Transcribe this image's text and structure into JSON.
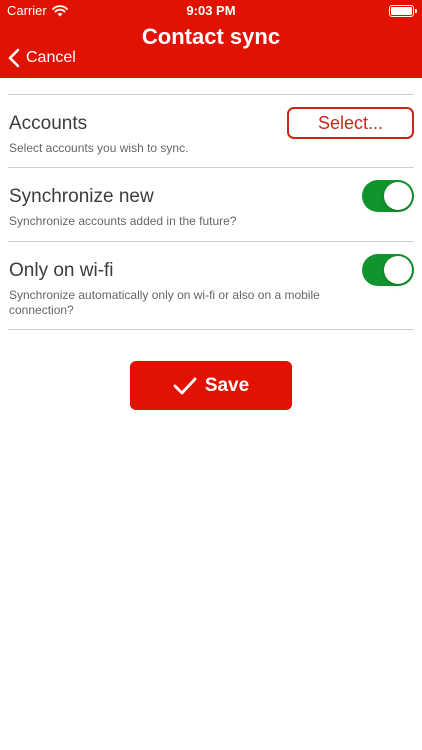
{
  "status_bar": {
    "carrier": "Carrier",
    "time": "9:03 PM",
    "icons": [
      "wifi-icon",
      "battery-icon"
    ]
  },
  "nav": {
    "back_label": "Cancel",
    "title": "Contact sync",
    "back_icon": "chevron-left-icon"
  },
  "settings": {
    "accounts": {
      "label": "Accounts",
      "description": "Select accounts you wish to sync.",
      "button_label": "Select..."
    },
    "sync_new": {
      "label": "Synchronize new",
      "description": "Synchronize accounts added in the future?",
      "enabled": true
    },
    "wifi_only": {
      "label": "Only on wi-fi",
      "description": "Synchronize automatically only on wi-fi or also on a mobile connection?",
      "enabled": true
    }
  },
  "save": {
    "label": "Save",
    "icon": "checkmark-icon"
  },
  "colors": {
    "brand_red": "#e21203",
    "toggle_on": "#10952e",
    "outline_red": "#c9261c"
  }
}
